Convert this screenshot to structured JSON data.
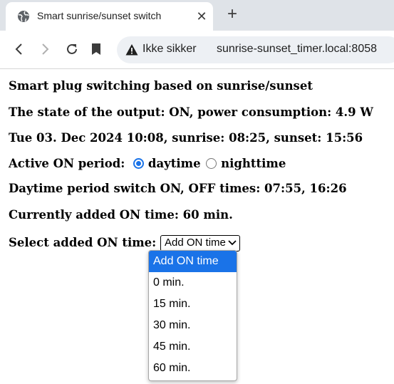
{
  "browser": {
    "tab": {
      "title": "Smart sunrise/sunset switch",
      "favicon": "globe-icon"
    },
    "security_label": "Ikke sikker",
    "url": "sunrise-sunset_timer.local:8058"
  },
  "page": {
    "heading": "Smart plug switching based on sunrise/sunset",
    "output_state": "The state of the output: ON, power consumption: 4.9 W",
    "date_line": "Tue 03. Dec 2024 10:08, sunrise: 08:25, sunset: 15:56",
    "active_period": {
      "label": "Active ON period:",
      "options": [
        "daytime",
        "nighttime"
      ],
      "selected": "daytime"
    },
    "switch_times": "Daytime period switch ON, OFF times: 07:55, 16:26",
    "added_on_time": "Currently added ON time: 60 min.",
    "select_label": "Select added ON time:",
    "select_value": "Add ON time",
    "dropdown_options": [
      "Add ON time",
      "0 min.",
      "15 min.",
      "30 min.",
      "45 min.",
      "60 min."
    ]
  },
  "colors": {
    "accent": "#1a73e8",
    "tabstrip": "#dfe3e8",
    "omnibox": "#edf0f4"
  }
}
